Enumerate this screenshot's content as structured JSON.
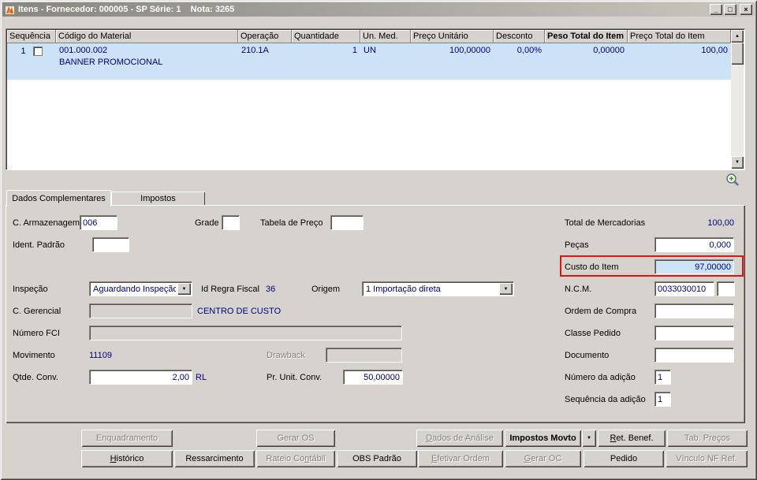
{
  "window": {
    "title": "Itens - Fornecedor: 000005 - SP Série: 1    Nota: 3265",
    "minimize_glyph": "_",
    "maximize_glyph": "□",
    "close_glyph": "×"
  },
  "icons": {
    "scroll_up": "▲",
    "scroll_down": "▼",
    "combo_arrow": "▼",
    "dropdown_arrow": "▼"
  },
  "grid": {
    "columns": [
      {
        "label": "Sequência"
      },
      {
        "label": "Código do Material"
      },
      {
        "label": "Operação"
      },
      {
        "label": "Quantidade"
      },
      {
        "label": "Un. Med."
      },
      {
        "label": "Preço Unitário"
      },
      {
        "label": "Desconto"
      },
      {
        "label": "Peso Total do Item"
      },
      {
        "label": "Preço Total do Item"
      }
    ],
    "row": {
      "seq": "1",
      "code": "001.000.002",
      "description": "BANNER PROMOCIONAL",
      "operation": "210.1A",
      "quantity": "1",
      "unit": "UN",
      "unit_price": "100,00000",
      "discount": "0,00%",
      "total_weight": "0,00000",
      "total_price": "100,00"
    }
  },
  "tabs": {
    "complementares": "Dados Complementares",
    "impostos": "Impostos"
  },
  "form": {
    "c_armazenagem": {
      "label": "C. Armazenagem",
      "value": "006"
    },
    "grade": {
      "label": "Grade",
      "value": ""
    },
    "tabela_preco": {
      "label": "Tabela de Preço",
      "value": ""
    },
    "ident_padrao": {
      "label": "Ident. Padrão",
      "value": ""
    },
    "total_mercadorias": {
      "label": "Total de Mercadorias",
      "value": "100,00"
    },
    "pecas": {
      "label": "Peças",
      "value": "0,000"
    },
    "custo_item": {
      "label": "Custo do Item",
      "value": "97,00000"
    },
    "inspecao": {
      "label": "Inspeção",
      "value": "Aguardando Inspeção"
    },
    "id_regra_fiscal": {
      "label": "Id Regra Fiscal",
      "value": "36"
    },
    "origem": {
      "label": "Origem",
      "value": "1 Importação direta"
    },
    "ncm": {
      "label": "N.C.M.",
      "value": "0033030010",
      "extra": ""
    },
    "c_gerencial": {
      "label": "C. Gerencial",
      "value": "",
      "note": "CENTRO DE CUSTO"
    },
    "ordem_compra": {
      "label": "Ordem de Compra",
      "value": ""
    },
    "numero_fci": {
      "label": "Número FCI",
      "value": ""
    },
    "classe_pedido": {
      "label": "Classe Pedido",
      "value": ""
    },
    "movimento": {
      "label": "Movimento",
      "value": "11109"
    },
    "drawback": {
      "label": "Drawback",
      "value": ""
    },
    "documento": {
      "label": "Documento",
      "value": ""
    },
    "qtde_conv": {
      "label": "Qtde. Conv.",
      "value": "2,00",
      "unit": "RL"
    },
    "pr_unit_conv": {
      "label": "Pr. Unit. Conv.",
      "value": "50,00000"
    },
    "numero_adicao": {
      "label": "Número da adição",
      "value": "1"
    },
    "sequencia_adicao": {
      "label": "Sequência da adição",
      "value": "1"
    }
  },
  "buttons": {
    "row1": [
      {
        "label": "Enquadramento"
      },
      {
        "label": "Gerar OS"
      },
      {
        "label": "Dados de Análise"
      },
      {
        "label": "Impostos Movto"
      },
      {
        "label": "Ret. Benef."
      },
      {
        "label": "Tab. Preços"
      }
    ],
    "row2": [
      {
        "label": "Histórico"
      },
      {
        "label": "Ressarcimento"
      },
      {
        "label": "Rateio Contábil"
      },
      {
        "label": "OBS Padrão"
      },
      {
        "label": "Efetivar Ordem"
      },
      {
        "label": "Gerar OC"
      },
      {
        "label": "Pedido"
      },
      {
        "label": "Vínculo NF Ref."
      }
    ]
  },
  "colors": {
    "navy": "#000080",
    "row_highlight": "#cbe2f7",
    "annotation_red": "#e01212",
    "custo_bg": "#cde4f7"
  }
}
